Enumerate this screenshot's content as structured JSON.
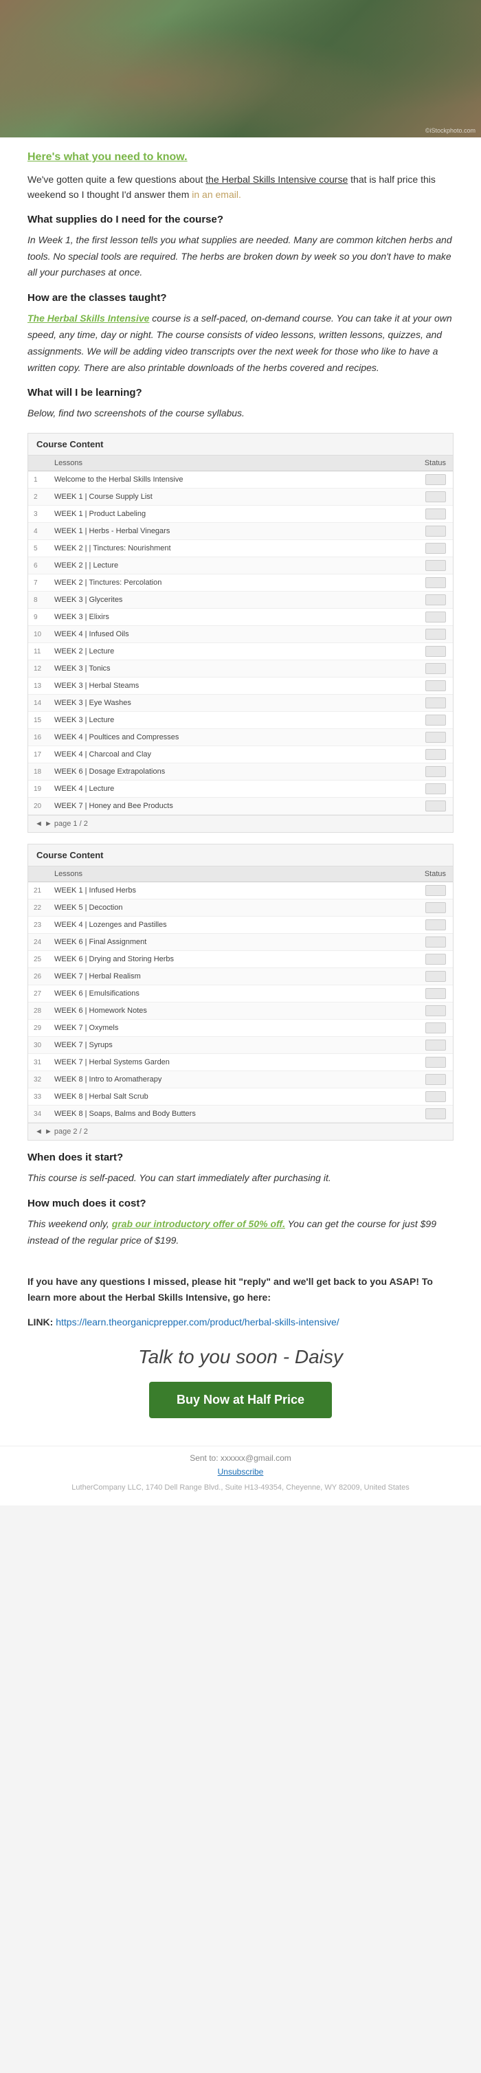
{
  "hero": {
    "credit": "©iStockphoto.com"
  },
  "header": {
    "heading": "Here's what you need to know."
  },
  "intro": {
    "text_before_link": "We've gotten quite a few questions about ",
    "link_text": "the Herbal Skills Intensive course",
    "text_after_link": " that is half price this weekend so I thought I'd answer them ",
    "email_text": "in an email."
  },
  "qa": [
    {
      "question": "What supplies do I need for the course?",
      "answer": "In Week 1, the first lesson tells you what supplies are needed. Many are common kitchen herbs and tools. No special tools are required. The herbs are broken down by week so you don't have to make all your purchases at once."
    },
    {
      "question": "How are the classes taught?",
      "answer_prefix": "",
      "answer_link": "The Herbal Skills Intensive",
      "answer_suffix": " course is a self-paced, on-demand course. You can take it at your own speed, any time, day or night. The course consists of video lessons, written lessons, quizzes, and assignments. We will be adding video transcripts over the next week for those who like to have a written copy. There are also printable downloads of the herbs covered and recipes."
    },
    {
      "question": "What will I be learning?",
      "answer": "Below, find two screenshots of the course syllabus."
    }
  ],
  "course_table_1": {
    "title": "Course Content",
    "col_lessons": "Lessons",
    "col_status": "Status",
    "rows": [
      {
        "num": "1",
        "label": "Welcome to the Herbal Skills Intensive"
      },
      {
        "num": "2",
        "label": "WEEK 1 | Course Supply List"
      },
      {
        "num": "3",
        "label": "WEEK 1 | Product Labeling"
      },
      {
        "num": "4",
        "label": "WEEK 1 | Herbs - Herbal Vinegars"
      },
      {
        "num": "5",
        "label": "WEEK 2 | | Tinctures: Nourishment"
      },
      {
        "num": "6",
        "label": "WEEK 2 | | Lecture"
      },
      {
        "num": "7",
        "label": "WEEK 2 | Tinctures: Percolation"
      },
      {
        "num": "8",
        "label": "WEEK 3 | Glycerites"
      },
      {
        "num": "9",
        "label": "WEEK 3 | Elixirs"
      },
      {
        "num": "10",
        "label": "WEEK 4 | Infused Oils"
      },
      {
        "num": "11",
        "label": "WEEK 2 | Lecture"
      },
      {
        "num": "12",
        "label": "WEEK 3 | Tonics"
      },
      {
        "num": "13",
        "label": "WEEK 3 | Herbal Steams"
      },
      {
        "num": "14",
        "label": "WEEK 3 | Eye Washes"
      },
      {
        "num": "15",
        "label": "WEEK 3 | Lecture"
      },
      {
        "num": "16",
        "label": "WEEK 4 | Poultices and Compresses"
      },
      {
        "num": "17",
        "label": "WEEK 4 | Charcoal and Clay"
      },
      {
        "num": "18",
        "label": "WEEK 6 | Dosage Extrapolations"
      },
      {
        "num": "19",
        "label": "WEEK 4 | Lecture"
      },
      {
        "num": "20",
        "label": "WEEK 7 | Honey and Bee Products"
      }
    ],
    "footer": "◄  ►  page 1 / 2"
  },
  "course_table_2": {
    "title": "Course Content",
    "col_lessons": "Lessons",
    "col_status": "Status",
    "rows": [
      {
        "num": "21",
        "label": "WEEK 1 | Infused Herbs"
      },
      {
        "num": "22",
        "label": "WEEK 5 | Decoction"
      },
      {
        "num": "23",
        "label": "WEEK 4 | Lozenges and Pastilles"
      },
      {
        "num": "24",
        "label": "WEEK 6 | Final Assignment"
      },
      {
        "num": "25",
        "label": "WEEK 6 | Drying and Storing Herbs"
      },
      {
        "num": "26",
        "label": "WEEK 7 | Herbal Realism"
      },
      {
        "num": "27",
        "label": "WEEK 6 | Emulsifications"
      },
      {
        "num": "28",
        "label": "WEEK 6 | Homework Notes"
      },
      {
        "num": "29",
        "label": "WEEK 7 | Oxymels"
      },
      {
        "num": "30",
        "label": "WEEK 7 | Syrups"
      },
      {
        "num": "31",
        "label": "WEEK 7 | Herbal Systems Garden"
      },
      {
        "num": "32",
        "label": "WEEK 8 | Intro to Aromatherapy"
      },
      {
        "num": "33",
        "label": "WEEK 8 | Herbal Salt Scrub"
      },
      {
        "num": "34",
        "label": "WEEK 8 | Soaps, Balms and Body Butters"
      }
    ],
    "footer": "◄  ►  page 2 / 2"
  },
  "when_cost": [
    {
      "question": "When does it start?",
      "answer": "This course is self-paced. You can start immediately after purchasing it."
    },
    {
      "question": "How much does it cost?",
      "answer_prefix": "This weekend only, ",
      "answer_link": "grab our introductory offer of 50% off.",
      "answer_suffix": " You can get the course for just $99 instead of the regular price of $199."
    }
  ],
  "cta": {
    "bold_text": "If you have any questions I missed, please hit \"reply\" and we'll get back to you ASAP! To learn more about the Herbal Skills Intensive, go here:",
    "link_label": "LINK:",
    "link_url": "https://learn.theorganicprepper.com/product/herbal-skills-intensive/",
    "signature": "Talk to you soon - Daisy",
    "button_label": "Buy Now at Half Price"
  },
  "footer": {
    "sent_label": "Sent to:",
    "sent_email": "xxxxxx@gmail.com",
    "unsubscribe": "Unsubscribe",
    "company": "LutherCompany LLC, 1740 Dell Range Blvd., Suite H13-49354, Cheyenne, WY 82009, United States"
  }
}
